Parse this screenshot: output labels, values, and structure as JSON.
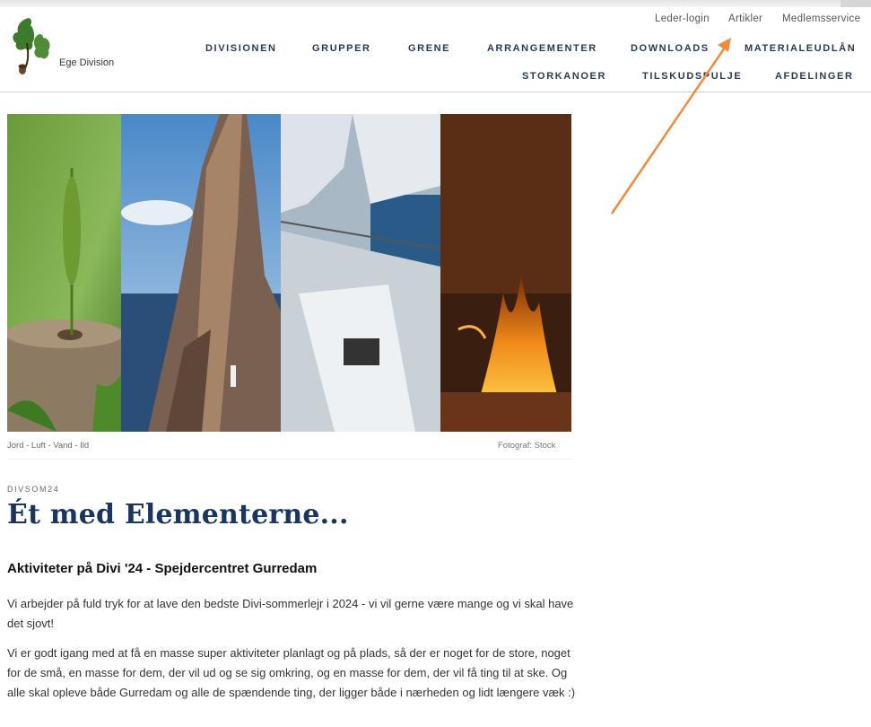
{
  "header": {
    "logo_text": "Ege Division",
    "util_links": [
      "Leder-login",
      "Artikler",
      "Medlemsservice"
    ],
    "nav_row1": [
      "DIVISIONEN",
      "GRUPPER",
      "GRENE",
      "ARRANGEMENTER",
      "DOWNLOADS",
      "MATERIALEUDLÅN"
    ],
    "nav_row2": [
      "STORKANOER",
      "TILSKUDSPULJE",
      "AFDELINGER"
    ]
  },
  "hero": {
    "caption": "Jord - Luft - Vand - Ild",
    "credit": "Fotograf: Stock"
  },
  "article": {
    "kicker": "DIVSOM24",
    "title": "Ét med Elementerne...",
    "subtitle": "Aktiviteter på Divi '24 - Spejdercentret Gurredam",
    "paragraph1": "Vi arbejder på fuld tryk for at lave den bedste Divi-sommerlejr i 2024 - vi vil gerne være mange og vi skal have det sjovt!",
    "paragraph2": "Vi er godt igang med at få en masse super aktiviteter planlagt og på plads, så der er noget for de store, noget for de små, en masse for dem, der vil ud og se sig omkring, og en masse for dem, der vil få ting til at ske. Og alle skal opleve både Gurredam og alle de spændende ting, der ligger både i nærheden og lidt længere væk :)"
  },
  "colors": {
    "nav": "#2a3a55",
    "title": "#1a3560",
    "annotation_arrow": "#f08a3c"
  }
}
